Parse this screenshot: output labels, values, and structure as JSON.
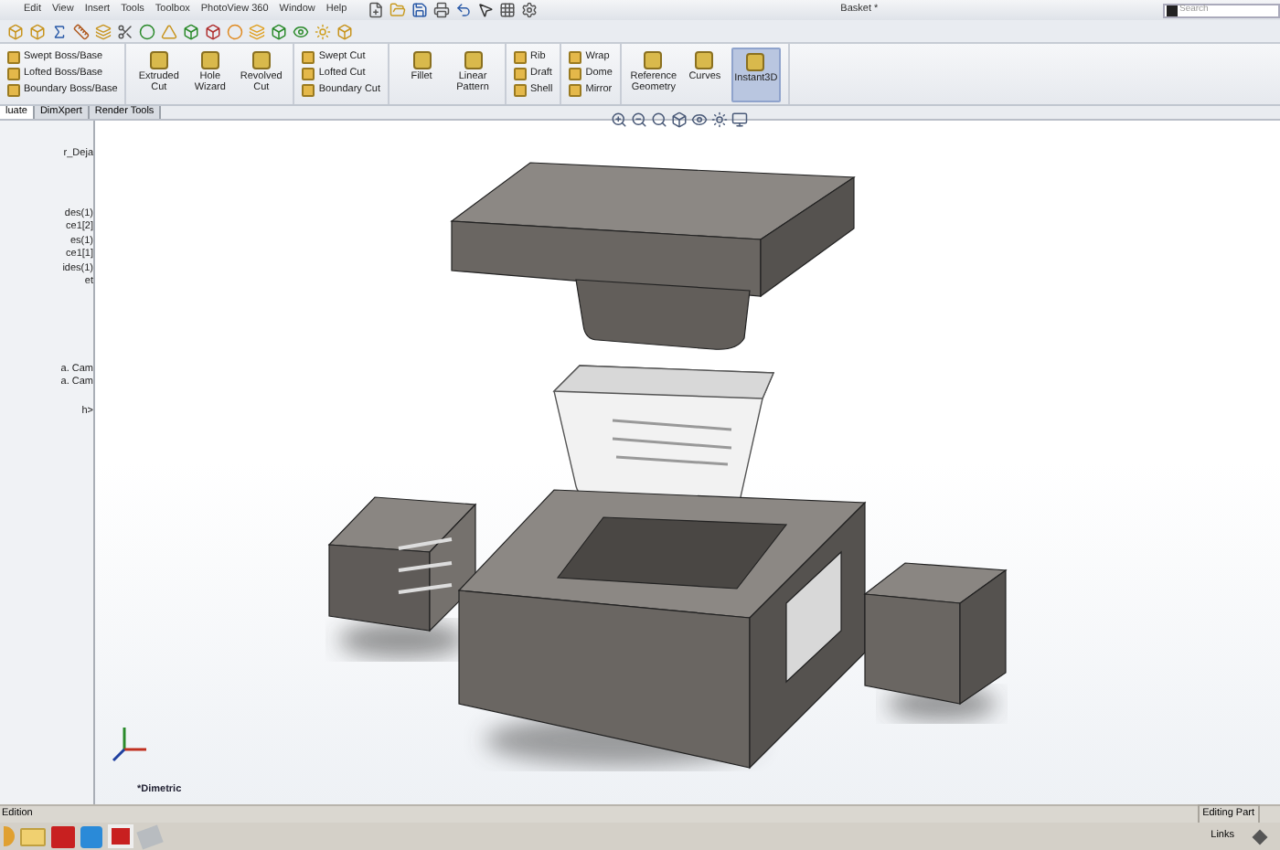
{
  "window": {
    "title": "Basket *"
  },
  "menu": [
    "Edit",
    "View",
    "Insert",
    "Tools",
    "Toolbox",
    "PhotoView 360",
    "Window",
    "Help"
  ],
  "search": {
    "placeholder": "Search"
  },
  "commands": [
    {
      "kind": "stack",
      "items": [
        {
          "label": "Swept Boss/Base"
        },
        {
          "label": "Lofted Boss/Base"
        },
        {
          "label": "Boundary Boss/Base"
        }
      ]
    },
    {
      "kind": "big",
      "items": [
        {
          "label": "Extruded Cut",
          "on": false
        },
        {
          "label": "Hole Wizard",
          "on": false
        },
        {
          "label": "Revolved Cut",
          "on": false
        }
      ]
    },
    {
      "kind": "stack",
      "items": [
        {
          "label": "Swept Cut"
        },
        {
          "label": "Lofted Cut"
        },
        {
          "label": "Boundary Cut"
        }
      ]
    },
    {
      "kind": "big",
      "items": [
        {
          "label": "Fillet",
          "on": false
        },
        {
          "label": "Linear Pattern",
          "on": false
        }
      ]
    },
    {
      "kind": "stack",
      "items": [
        {
          "label": "Rib"
        },
        {
          "label": "Draft"
        },
        {
          "label": "Shell"
        }
      ]
    },
    {
      "kind": "stack",
      "items": [
        {
          "label": "Wrap"
        },
        {
          "label": "Dome"
        },
        {
          "label": "Mirror"
        }
      ]
    },
    {
      "kind": "big",
      "items": [
        {
          "label": "Reference Geometry",
          "on": false
        },
        {
          "label": "Curves",
          "on": false
        },
        {
          "label": "Instant3D",
          "on": true
        }
      ]
    }
  ],
  "tabs": [
    {
      "label": "luate",
      "selected": true
    },
    {
      "label": "DimXpert",
      "selected": false
    },
    {
      "label": "Render Tools",
      "selected": false
    }
  ],
  "tree": [
    "r_Deja",
    "des(1)",
    "ce1[2]",
    "es(1)",
    "ce1[1]",
    "ides(1)",
    "et",
    "a. Cam",
    "a. Cam",
    "h>"
  ],
  "view": {
    "label": "*Dimetric"
  },
  "status": {
    "left": "Edition",
    "right": "Editing Part"
  },
  "taskbar": {
    "links": "Links"
  }
}
